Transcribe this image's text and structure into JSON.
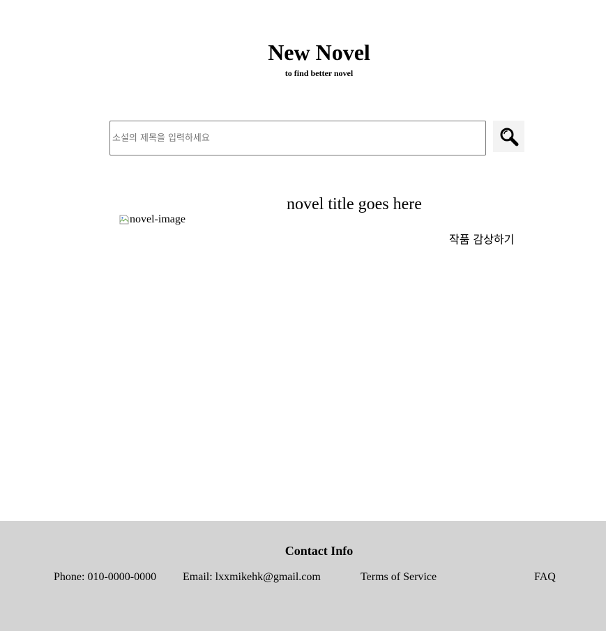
{
  "header": {
    "title": "New Novel",
    "subtitle": "to find better novel"
  },
  "search": {
    "placeholder": "소설의 제목을 입력하세요",
    "value": "",
    "button_icon": "magnifier-icon"
  },
  "novel": {
    "image_alt": "novel-image",
    "title": "novel title goes here",
    "read_link": "작품 감상하기"
  },
  "footer": {
    "heading": "Contact Info",
    "phone": "Phone: 010-0000-0000",
    "email": "Email: lxxmikehk@gmail.com",
    "terms": "Terms of Service",
    "faq": "FAQ"
  }
}
